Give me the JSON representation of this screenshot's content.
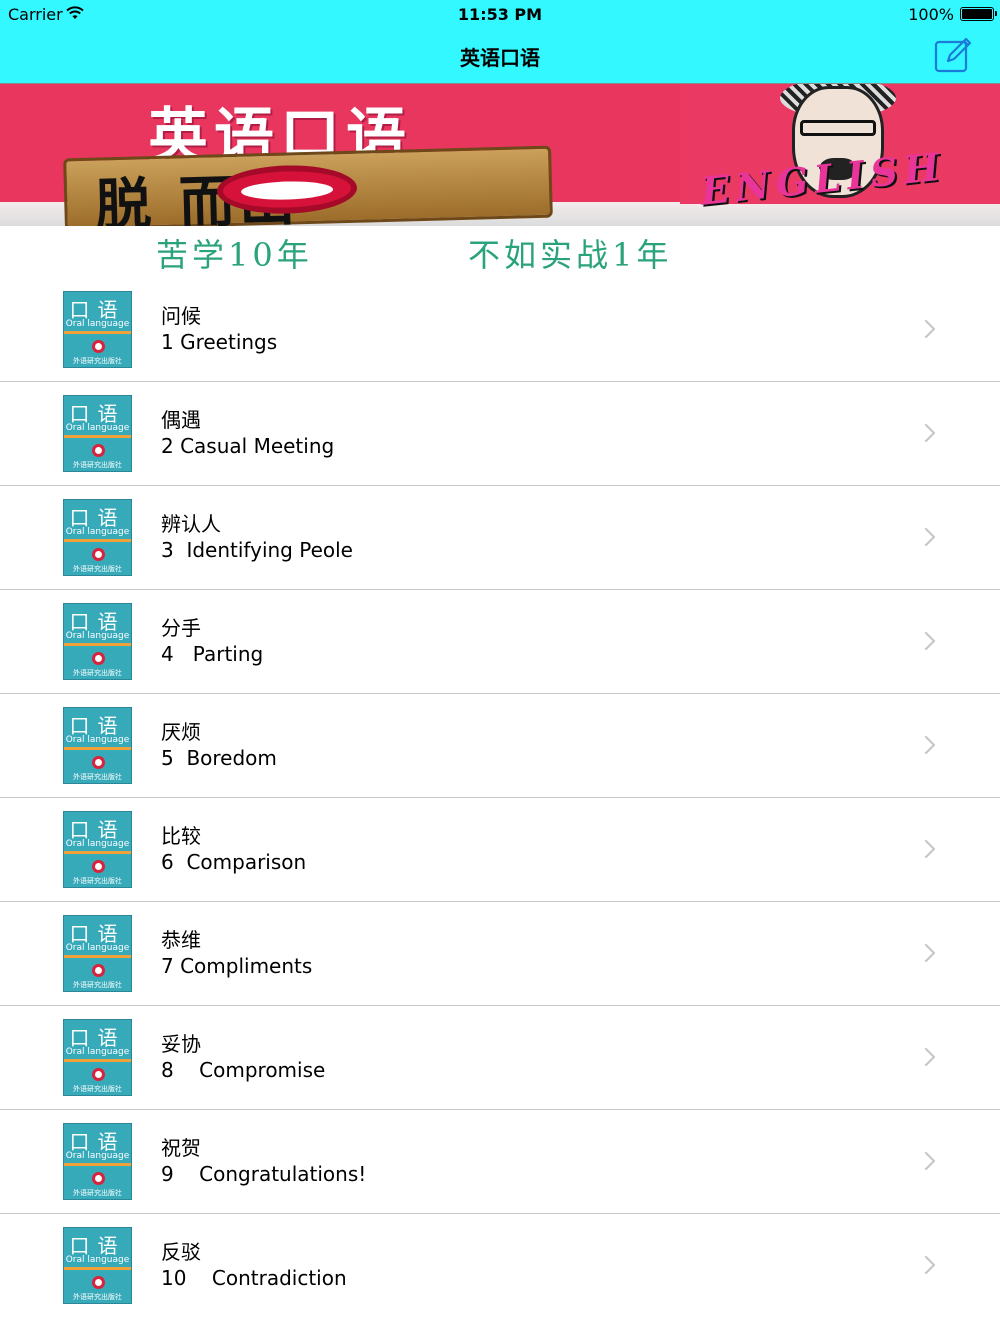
{
  "status_bar": {
    "carrier": "Carrier",
    "time": "11:53 PM",
    "battery": "100%"
  },
  "nav": {
    "title": "英语口语",
    "compose_icon": "compose-icon"
  },
  "banner": {
    "title": "英语口语",
    "sign_text": "脱  而出",
    "english_word": "ENGLISH"
  },
  "slogan": {
    "left": "苦学10年",
    "right": "不如实战1年"
  },
  "thumbnail": {
    "title": "口语",
    "subtitle": "Oral language",
    "publisher": "外语研究出版社"
  },
  "lessons": [
    {
      "cn": "问候",
      "en": "1 Greetings"
    },
    {
      "cn": "偶遇",
      "en": "2 Casual Meeting"
    },
    {
      "cn": "辨认人",
      "en": "3  Identifying Peole"
    },
    {
      "cn": "分手",
      "en": "4   Parting"
    },
    {
      "cn": "厌烦",
      "en": "5  Boredom"
    },
    {
      "cn": "比较",
      "en": "6  Comparison"
    },
    {
      "cn": "恭维",
      "en": "7 Compliments"
    },
    {
      "cn": "妥协",
      "en": "8    Compromise"
    },
    {
      "cn": "祝贺",
      "en": "9    Congratulations!"
    },
    {
      "cn": "反驳",
      "en": "10    Contradiction"
    }
  ],
  "colors": {
    "nav_background": "#33f8ff",
    "banner_background": "#e8365f",
    "slogan_text": "#2aa37d",
    "thumbnail_background": "#36aab9"
  }
}
